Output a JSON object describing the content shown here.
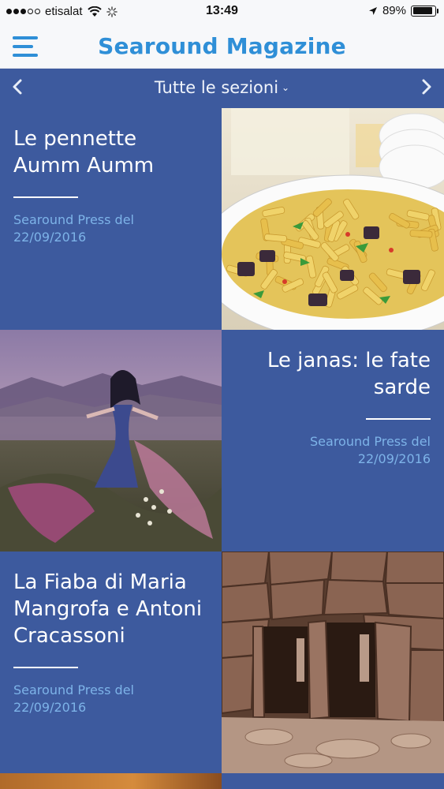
{
  "status": {
    "carrier": "etisalat",
    "time": "13:49",
    "battery": "89%",
    "battery_level": 0.89
  },
  "header": {
    "title": "Searound Magazine"
  },
  "nav": {
    "section": "Tutte le sezioni",
    "prev_icon": "chevron-left-icon",
    "next_icon": "chevron-right-icon"
  },
  "articles": [
    {
      "title": "Le pennette Aumm Aumm",
      "source": "Searound Press del",
      "date": "22/09/2016"
    },
    {
      "title": "Le janas: le fate sarde",
      "source": "Searound Press del",
      "date": "22/09/2016"
    },
    {
      "title": "La Fiaba di Maria Mangrofa e Antoni Cracassoni",
      "source": "Searound Press del",
      "date": "22/09/2016"
    }
  ]
}
